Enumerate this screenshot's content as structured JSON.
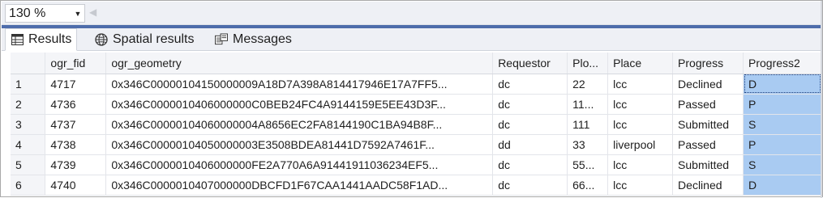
{
  "toolbar": {
    "zoom_value": "130 %",
    "zoom_arrow": "▼",
    "scroll_left": "◀"
  },
  "tabs": [
    {
      "label": "Results",
      "icon": "grid-icon",
      "active": true
    },
    {
      "label": "Spatial results",
      "icon": "globe-icon",
      "active": false
    },
    {
      "label": "Messages",
      "icon": "messages-icon",
      "active": false
    }
  ],
  "grid": {
    "columns": [
      "",
      "ogr_fid",
      "ogr_geometry",
      "Requestor",
      "Plo...",
      "Place",
      "Progress",
      "Progress2"
    ],
    "rows": [
      [
        "1",
        "4717",
        "0x346C00000104150000009A18D7A398A814417946E17A7FF5...",
        "dc",
        "22",
        "lcc",
        "Declined",
        "D"
      ],
      [
        "2",
        "4736",
        "0x346C0000010406000000C0BEB24FC4A9144159E5EE43D3F...",
        "dc",
        "11...",
        "lcc",
        "Passed",
        "P"
      ],
      [
        "3",
        "4737",
        "0x346C00000104060000004A8656EC2FA8144190C1BA94B8F...",
        "dc",
        "111",
        "lcc",
        "Submitted",
        "S"
      ],
      [
        "4",
        "4738",
        "0x346C00000104050000003E3508BDEA81441D7592A7461F...",
        "dd",
        "33",
        "liverpool",
        "Passed",
        "P"
      ],
      [
        "5",
        "4739",
        "0x346C0000010406000000FE2A770A6A9144191103623​4EF5...",
        "dc",
        "55...",
        "lcc",
        "Submitted",
        "S"
      ],
      [
        "6",
        "4740",
        "0x346C0000010407000000DBCFD1F67CAA1441AADC58F1AD...",
        "dc",
        "66...",
        "lcc",
        "Declined",
        "D"
      ]
    ]
  }
}
